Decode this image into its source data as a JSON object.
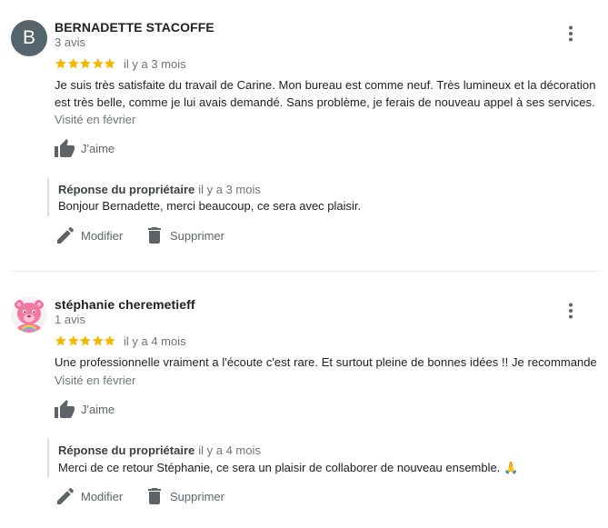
{
  "colors": {
    "star": "#f5b800",
    "text": "#202124",
    "secondary": "#70757a",
    "icon": "#5f6368",
    "avatar_bg": "#56646d"
  },
  "reviews": [
    {
      "avatar_letter": "B",
      "name": "BERNADETTE STACOFFE",
      "count": "3 avis",
      "rating": 5,
      "date": "il y a 3 mois",
      "text": "Je suis très satisfaite du travail de Carine. Mon bureau est comme neuf. Très lumineux et la décoration est très belle, comme je lui avais demandé. Sans problème, je ferais de nouveau appel à ses services.",
      "visited": "Visité en février",
      "like_label": "J'aime",
      "reply": {
        "title": "Réponse du propriétaire",
        "date": "il y a 3 mois",
        "text": "Bonjour Bernadette, merci beaucoup, ce sera avec plaisir."
      },
      "edit_label": "Modifier",
      "delete_label": "Supprimer"
    },
    {
      "avatar_icon": "care-bear-avatar-icon",
      "name": "stéphanie cheremetieff",
      "count": "1 avis",
      "rating": 5,
      "date": "il y a 4 mois",
      "text": "Une professionnelle vraiment a l'écoute c'est rare. Et surtout pleine de bonnes idées !! Je recommande",
      "visited": "Visité en février",
      "like_label": "J'aime",
      "reply": {
        "title": "Réponse du propriétaire",
        "date": "il y a 4 mois",
        "text": "Merci de ce retour Stéphanie, ce sera un plaisir de collaborer de nouveau ensemble. 🙏"
      },
      "edit_label": "Modifier",
      "delete_label": "Supprimer"
    }
  ]
}
